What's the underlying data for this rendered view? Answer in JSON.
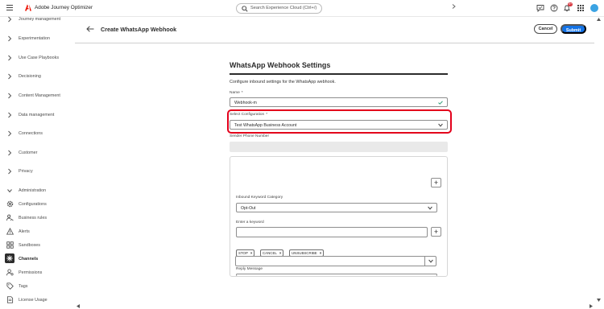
{
  "topbar": {
    "app_name": "Adobe Journey Optimizer",
    "search_placeholder": "Search Experience Cloud (Ctrl+/)",
    "notification_count": "9+",
    "brand_color": "#eb1000",
    "avatar_color": "#3aa3e3"
  },
  "sidebar": {
    "collapsible": [
      {
        "label": "Journey management"
      },
      {
        "label": "Experimentation"
      },
      {
        "label": "Use Case Playbooks"
      },
      {
        "label": "Decisioning"
      },
      {
        "label": "Content Management"
      },
      {
        "label": "Data management"
      },
      {
        "label": "Connections"
      },
      {
        "label": "Customer"
      },
      {
        "label": "Privacy"
      }
    ],
    "admin_label": "Administration",
    "admin_items": [
      {
        "label": "Configurations",
        "icon": "gear-icon"
      },
      {
        "label": "Business rules",
        "icon": "business-rules-icon"
      },
      {
        "label": "Alerts",
        "icon": "alert-icon"
      },
      {
        "label": "Sandboxes",
        "icon": "sandboxes-icon"
      },
      {
        "label": "Channels",
        "icon": "channels-icon",
        "active": true
      },
      {
        "label": "Permissions",
        "icon": "permissions-icon"
      },
      {
        "label": "Tags",
        "icon": "tag-icon"
      },
      {
        "label": "License Usage",
        "icon": "license-icon"
      }
    ]
  },
  "header": {
    "title": "Create WhatsApp Webhook",
    "cancel_label": "Cancel",
    "submit_label": "Submit",
    "accent_color": "#1473e6"
  },
  "form": {
    "section_title": "WhatsApp Webhook Settings",
    "description": "Configure inbound settings for the WhatsApp webhook.",
    "name_label": "Name",
    "name_value": "Webhook-m",
    "config_label": "Select Configuration",
    "config_value": "Test WhatsApp Business Account",
    "phone_label": "Sender Phone Number",
    "required_marker": "*",
    "highlight_color": "#e3001b",
    "category_label": "Inbound Keyword Category",
    "category_value": "Opt-Out",
    "keyword_label": "Enter a keyword",
    "keyword_value": "",
    "keywords": [
      {
        "label": "STOP"
      },
      {
        "label": "CANCEL"
      },
      {
        "label": "UNSUBSCRIBE"
      }
    ],
    "tag_remove": "×",
    "reply_label": "Reply Message",
    "reply_value": "",
    "add_glyph": "+"
  }
}
